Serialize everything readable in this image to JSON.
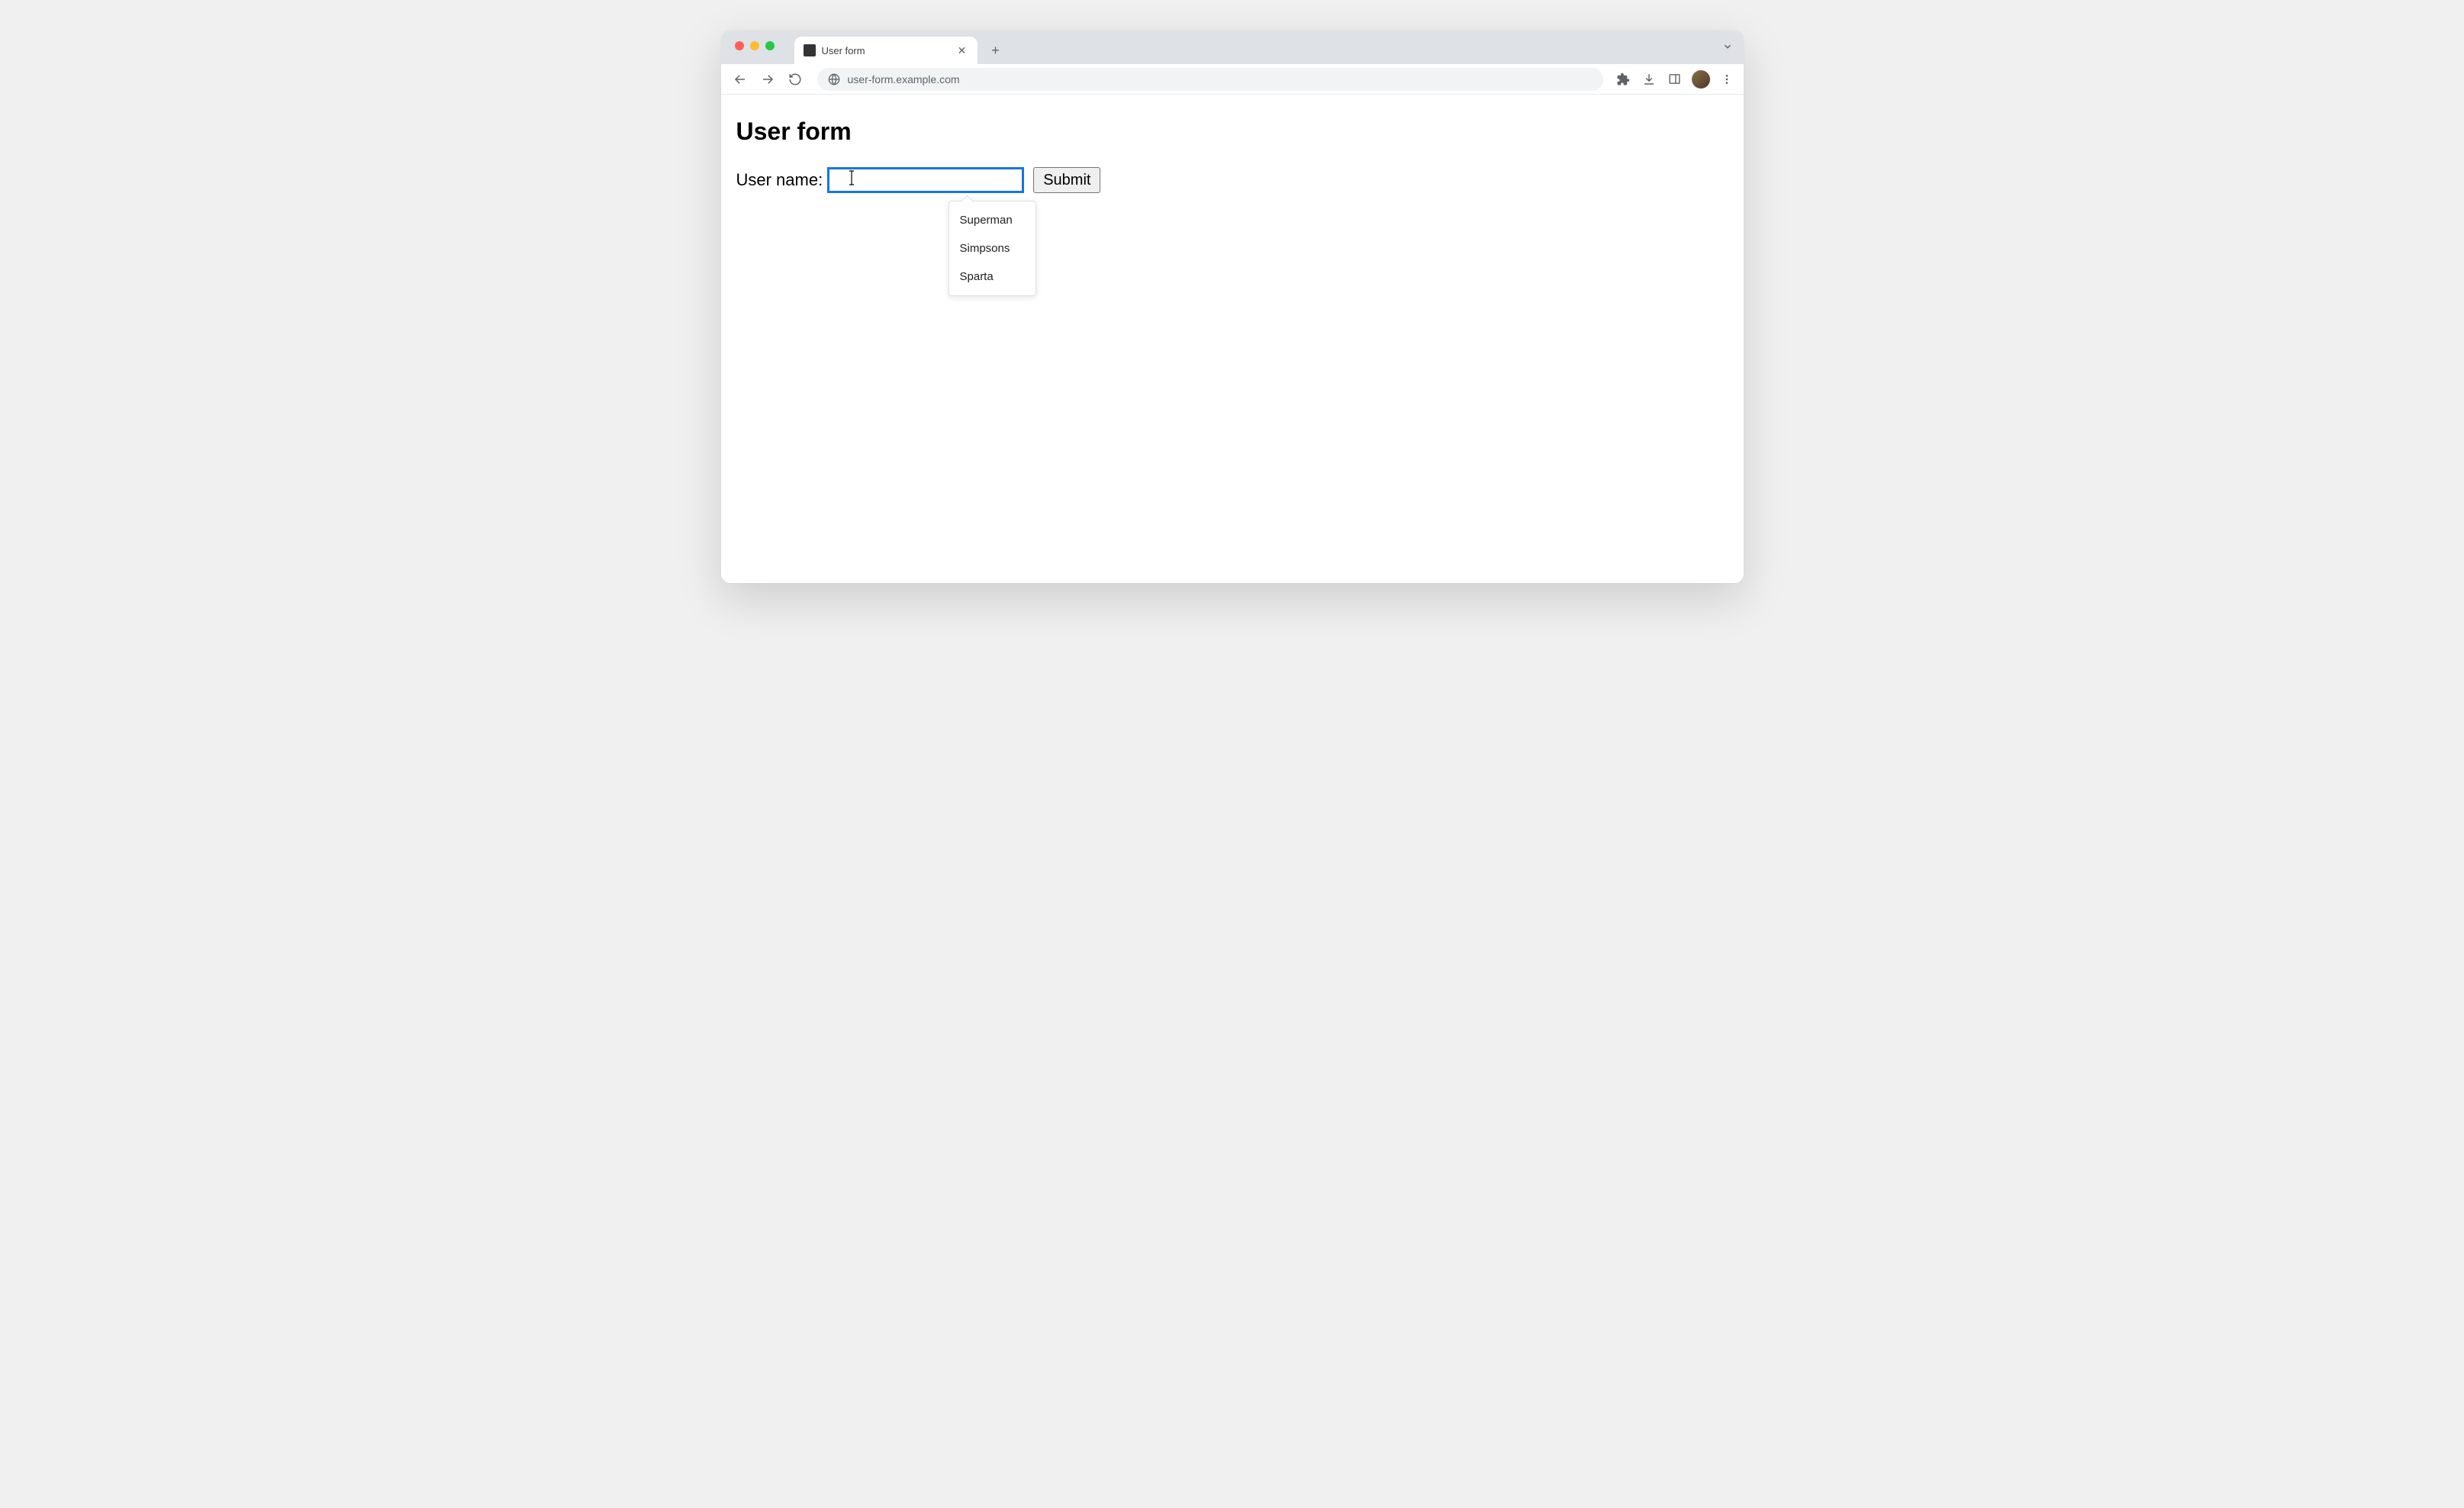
{
  "browser": {
    "tab_title": "User form",
    "url": "user-form.example.com"
  },
  "page": {
    "heading": "User form",
    "form": {
      "username_label": "User name:",
      "username_value": "",
      "submit_label": "Submit"
    },
    "autocomplete": {
      "items": [
        "Superman",
        "Simpsons",
        "Sparta"
      ]
    }
  }
}
